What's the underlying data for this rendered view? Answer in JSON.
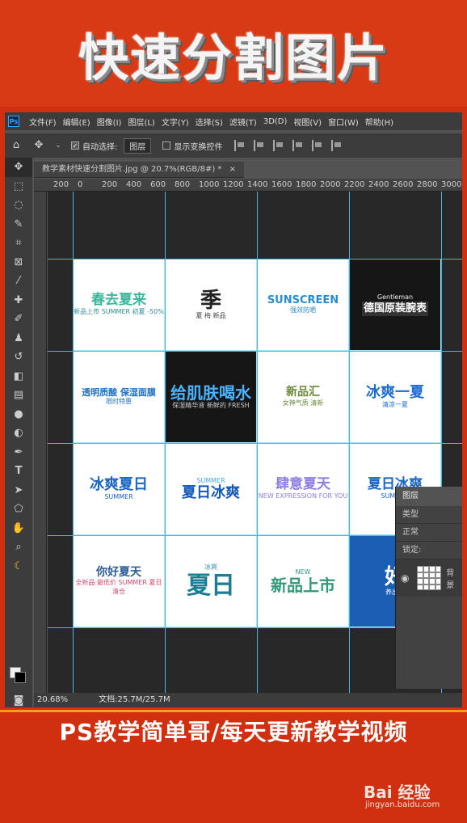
{
  "banner": {
    "title": "快速分割图片"
  },
  "app": {
    "logo": "Ps",
    "menu": [
      "文件(F)",
      "编辑(E)",
      "图像(I)",
      "图层(L)",
      "文字(Y)",
      "选择(S)",
      "滤镜(T)",
      "3D(D)",
      "视图(V)",
      "窗口(W)",
      "帮助(H)"
    ]
  },
  "options": {
    "auto_select_label": "自动选择:",
    "auto_select_value": "图层",
    "transform_label": "显示变换控件"
  },
  "tab": {
    "title": "教学素材快速分割图片.jpg @ 20.7%(RGB/8#) *",
    "close": "×"
  },
  "ruler": [
    "200",
    "0",
    "200",
    "400",
    "600",
    "800",
    "1000",
    "1200",
    "1400",
    "1600",
    "1800",
    "2000",
    "2200",
    "2400",
    "2600",
    "2800",
    "3000"
  ],
  "cells": [
    {
      "title": "春去夏来",
      "sub": "新品上市 SUMMER 初夏 -50%"
    },
    {
      "title": "季",
      "sub": "夏 梅 新品"
    },
    {
      "title": "SUNSCREEN",
      "sub": "强效防晒"
    },
    {
      "title": "德国原装腕表",
      "sub": "Gentleman"
    },
    {
      "title": "透明质酸 保湿面膜",
      "sub": "限时特惠"
    },
    {
      "title": "给肌肤喝水",
      "sub": "保湿精华液 新鲜的 FRESH"
    },
    {
      "title": "新品汇",
      "sub": "女神气质 清新"
    },
    {
      "title": "冰爽一夏",
      "sub": "清凉一夏"
    },
    {
      "title": "冰爽夏日",
      "sub": "SUMMER"
    },
    {
      "title": "夏日冰爽",
      "sub": "SUMMER"
    },
    {
      "title": "肆意夏天",
      "sub": "NEW EXPRESSION FOR YOU"
    },
    {
      "title": "夏日冰爽",
      "sub": "SUMMER"
    },
    {
      "title": "你好夏天",
      "sub": "全新品·最低价 SUMMER 夏日清仓"
    },
    {
      "title": "夏日",
      "sub": "冰爽"
    },
    {
      "title": "新品上市",
      "sub": "NEW"
    },
    {
      "title": "好",
      "sub": "养出嫩"
    }
  ],
  "layers": {
    "title": "图层",
    "kind": "类型",
    "mode": "正常",
    "lock": "锁定:",
    "layer_name": "背景"
  },
  "status": {
    "zoom": "20.68%",
    "doc": "文档:25.7M/25.7M"
  },
  "footer": {
    "text": "PS教学简单哥/每天更新教学视频",
    "wm_logo": "Bai 经验",
    "wm_url": "jingyan.baidu.com"
  }
}
